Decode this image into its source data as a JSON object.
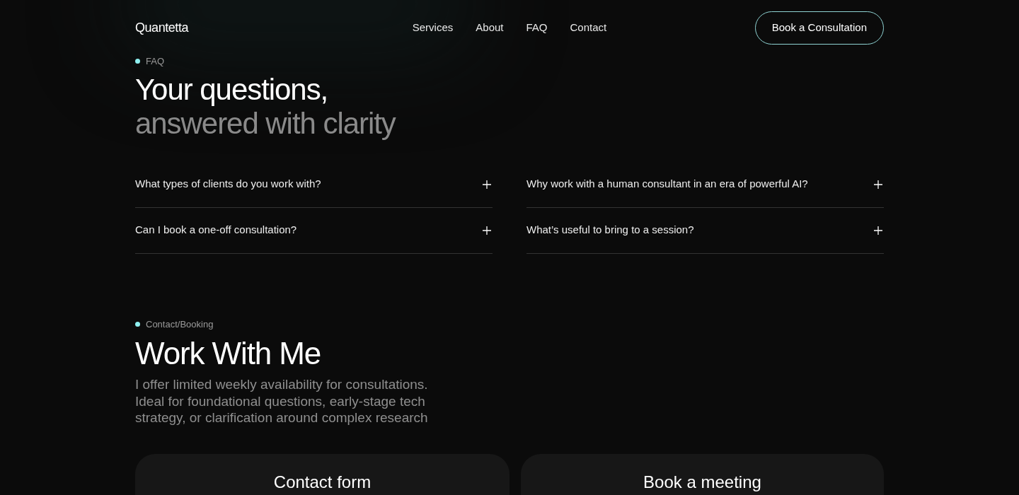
{
  "brand": "Quantetta",
  "nav": [
    {
      "label": "Services"
    },
    {
      "label": "About"
    },
    {
      "label": "FAQ"
    },
    {
      "label": "Contact"
    }
  ],
  "cta": "Book a Consultation",
  "faq": {
    "eyebrow": "FAQ",
    "title_line_1": "Your questions,",
    "title_line_2": "answered with clarity",
    "items": [
      {
        "question": "What types of clients do you work with?",
        "expanded": false
      },
      {
        "question": "Why work with a human consultant in an era of powerful AI?",
        "expanded": false
      },
      {
        "question": "Can I book a one-off consultation?",
        "expanded": false
      },
      {
        "question": "What’s useful to bring to a session?",
        "expanded": false
      }
    ]
  },
  "contact": {
    "eyebrow": "Contact/Booking",
    "title": "Work With Me",
    "description": "I offer limited weekly availability for consultations. Ideal for foundational questions, early-stage tech strategy, or clarification around complex research",
    "cards": [
      {
        "title": "Contact form"
      },
      {
        "title": "Book a meeting"
      }
    ]
  }
}
